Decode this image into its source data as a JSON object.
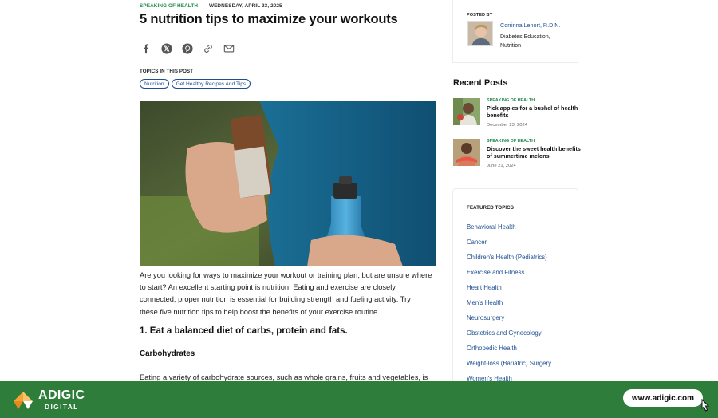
{
  "article": {
    "category": "SPEAKING OF HEALTH",
    "date": "WEDNESDAY, APRIL 23, 2025",
    "title": "5 nutrition tips to maximize your workouts",
    "share_icons": [
      "facebook-icon",
      "x-icon",
      "pinterest-icon",
      "link-icon",
      "email-icon"
    ],
    "topics_label": "TOPICS IN THIS POST",
    "topics": [
      "Nutrition",
      "Get Healthy Recipes And Tips"
    ],
    "intro_lines": [
      "Are you looking for ways to maximize your workout or training plan, but are unsure where",
      "to start? An excellent starting point is nutrition. Eating and exercise are closely",
      "connected; proper nutrition is essential for building strength and fueling activity. Try",
      "these five nutrition tips to help boost the benefits of your exercise routine."
    ],
    "section_heading": "1. Eat a balanced diet of carbs, protein and fats.",
    "subheading": "Carbohydrates",
    "body_line": "Eating a variety of carbohydrate sources, such as whole grains, fruits and vegetables, is"
  },
  "author": {
    "posted_by": "POSTED BY",
    "name": "Corrinna Lenort, R.D.N.",
    "specialty_line1": "Diabetes Education,",
    "specialty_line2": "Nutrition"
  },
  "recent": {
    "title": "Recent Posts",
    "items": [
      {
        "category": "SPEAKING OF HEALTH",
        "headline_line1": "Pick apples for a bushel of health",
        "headline_line2": "benefits",
        "date": "December 23, 2024"
      },
      {
        "category": "SPEAKING OF HEALTH",
        "headline_line1": "Discover the sweet health benefits",
        "headline_line2": "of summertime melons",
        "date": "June 21, 2024"
      }
    ]
  },
  "featured": {
    "label": "FEATURED TOPICS",
    "links": [
      "Behavioral Health",
      "Cancer",
      "Children's Health (Pediatrics)",
      "Exercise and Fitness",
      "Heart Health",
      "Men's Health",
      "Neurosurgery",
      "Obstetrics and Gynecology",
      "Orthopedic Health",
      "Weight-loss (Bariatric) Surgery",
      "Women's Health"
    ]
  },
  "banner": {
    "brand_name": "ADIGIC",
    "brand_sub": "DIGITAL",
    "url": "www.adigic.com",
    "color": "#2e7d3a"
  },
  "colors": {
    "category_green": "#1f8a4c",
    "link_blue": "#1d4f91"
  }
}
